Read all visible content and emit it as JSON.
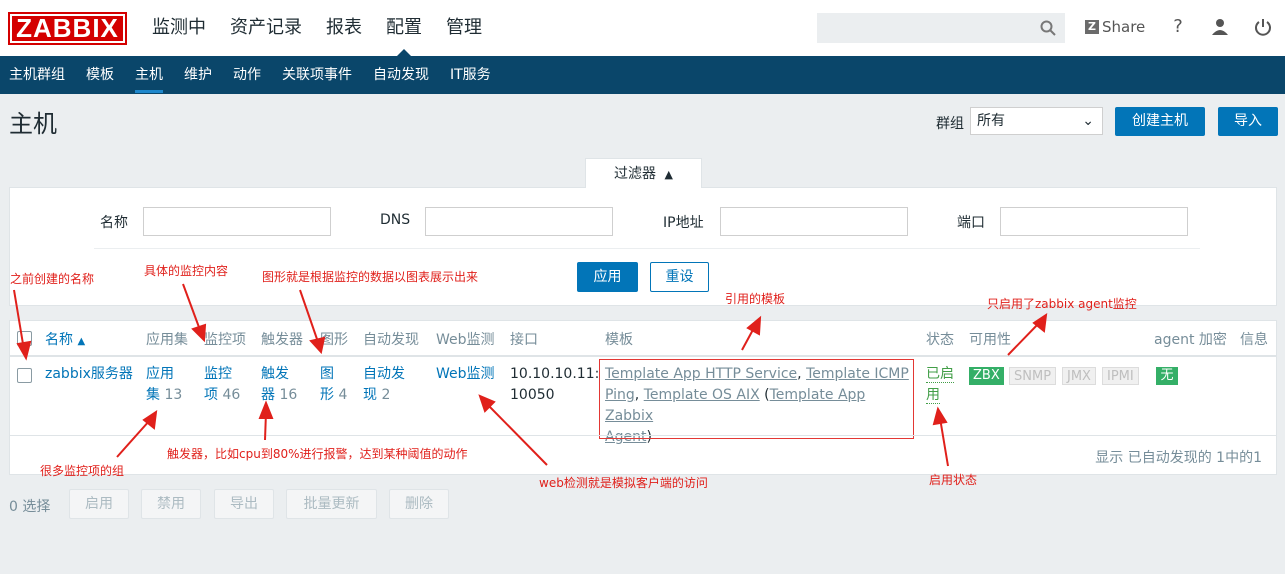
{
  "header": {
    "logo": "ZABBIX",
    "nav": [
      "监测中",
      "资产记录",
      "报表",
      "配置",
      "管理"
    ],
    "active_nav": "配置",
    "share": "Share",
    "share_badge": "Z",
    "help": "?"
  },
  "subnav": {
    "items": [
      "主机群组",
      "模板",
      "主机",
      "维护",
      "动作",
      "关联项事件",
      "自动发现",
      "IT服务"
    ],
    "active": "主机"
  },
  "page": {
    "title": "主机",
    "group_label": "群组",
    "group_value": "所有",
    "create_button": "创建主机",
    "import_button": "导入"
  },
  "filter": {
    "tab_label": "过滤器",
    "tab_arrow": "▲",
    "name_label": "名称",
    "dns_label": "DNS",
    "ip_label": "IP地址",
    "port_label": "端口",
    "apply": "应用",
    "reset": "重设"
  },
  "table": {
    "headers": {
      "name": "名称",
      "sort_arrow": "▲",
      "applications": "应用集",
      "items": "监控项",
      "triggers": "触发器",
      "graphs": "图形",
      "discovery": "自动发现",
      "web": "Web监测",
      "interface": "接口",
      "templates": "模板",
      "status": "状态",
      "availability": "可用性",
      "encryption": "agent 加密",
      "info": "信息"
    },
    "row": {
      "name": "zabbix服务器",
      "applications_a": "应用",
      "applications_b": "集",
      "applications_count": "13",
      "items_a": "监控",
      "items_b": "项",
      "items_count": "46",
      "triggers_a": "触发",
      "triggers_b": "器",
      "triggers_count": "16",
      "graphs_a": "图",
      "graphs_b": "形",
      "graphs_count": "4",
      "discovery_a": "自动发",
      "discovery_b": "现",
      "discovery_count": "2",
      "web": "Web监测",
      "interface_a": "10.10.10.11:",
      "interface_b": "10050",
      "tmpl1": "Template App HTTP Service",
      "tmpl2": "Template ICMP",
      "tmpl3": "Ping",
      "tmpl4": "Template OS AIX",
      "tmpl5": "Template App Zabbix",
      "tmpl6": "Agent",
      "status_a": "已启",
      "status_b": "用",
      "avail": [
        "ZBX",
        "SNMP",
        "JMX",
        "IPMI"
      ],
      "encryption": "无"
    },
    "footer": "显示 已自动发现的 1中的1"
  },
  "bottom": {
    "selected": "0 选择",
    "buttons": [
      "启用",
      "禁用",
      "导出",
      "批量更新",
      "删除"
    ]
  },
  "annotations": {
    "prev_name": "之前创建的名称",
    "monitor_content": "具体的监控内容",
    "graph_note": "图形就是根据监控的数据以图表展示出来",
    "template_note": "引用的模板",
    "zabbix_agent": "只启用了zabbix agent监控",
    "many_items": "很多监控项的组",
    "trigger_note": "触发器，比如cpu到80%进行报警，达到某种阈值的动作",
    "web_note": "web检测就是模拟客户端的访问",
    "status_note": "启用状态"
  },
  "colors": {
    "brand_red": "#d40000",
    "nav_blue": "#0a466a",
    "link_blue": "#0275b8",
    "green": "#34af67",
    "annotation_red": "#e0201b"
  }
}
